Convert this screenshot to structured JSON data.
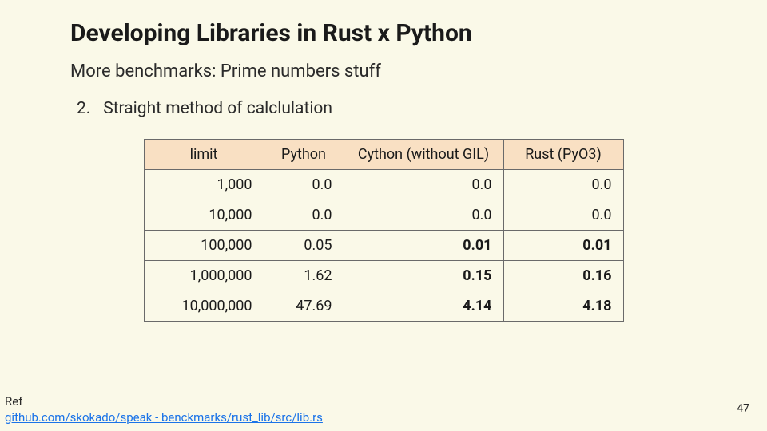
{
  "title": "Developing Libraries in Rust x Python",
  "subtitle": "More benchmarks: Prime numbers stuff",
  "list_number": "2.",
  "list_text": "Straight method of calclulation",
  "table": {
    "headers": [
      "limit",
      "Python",
      "Cython (without GIL)",
      "Rust (PyO3)"
    ],
    "rows": [
      {
        "cells": [
          "1,000",
          "0.0",
          "0.0",
          "0.0"
        ],
        "bold": [
          false,
          false,
          false,
          false
        ]
      },
      {
        "cells": [
          "10,000",
          "0.0",
          "0.0",
          "0.0"
        ],
        "bold": [
          false,
          false,
          false,
          false
        ]
      },
      {
        "cells": [
          "100,000",
          "0.05",
          "0.01",
          "0.01"
        ],
        "bold": [
          false,
          false,
          true,
          true
        ]
      },
      {
        "cells": [
          "1,000,000",
          "1.62",
          "0.15",
          "0.16"
        ],
        "bold": [
          false,
          false,
          true,
          true
        ]
      },
      {
        "cells": [
          "10,000,000",
          "47.69",
          "4.14",
          "4.18"
        ],
        "bold": [
          false,
          false,
          true,
          true
        ]
      }
    ]
  },
  "ref_label": "Ref",
  "ref_link": "github.com/skokado/speak - benckmarks/rust_lib/src/lib.rs",
  "page_number": "47",
  "chart_data": {
    "type": "table",
    "title": "Straight method of calculation benchmarks (seconds)",
    "columns": [
      "limit",
      "Python",
      "Cython (without GIL)",
      "Rust (PyO3)"
    ],
    "rows": [
      [
        1000,
        0.0,
        0.0,
        0.0
      ],
      [
        10000,
        0.0,
        0.0,
        0.0
      ],
      [
        100000,
        0.05,
        0.01,
        0.01
      ],
      [
        1000000,
        1.62,
        0.15,
        0.16
      ],
      [
        10000000,
        47.69,
        4.14,
        4.18
      ]
    ]
  }
}
